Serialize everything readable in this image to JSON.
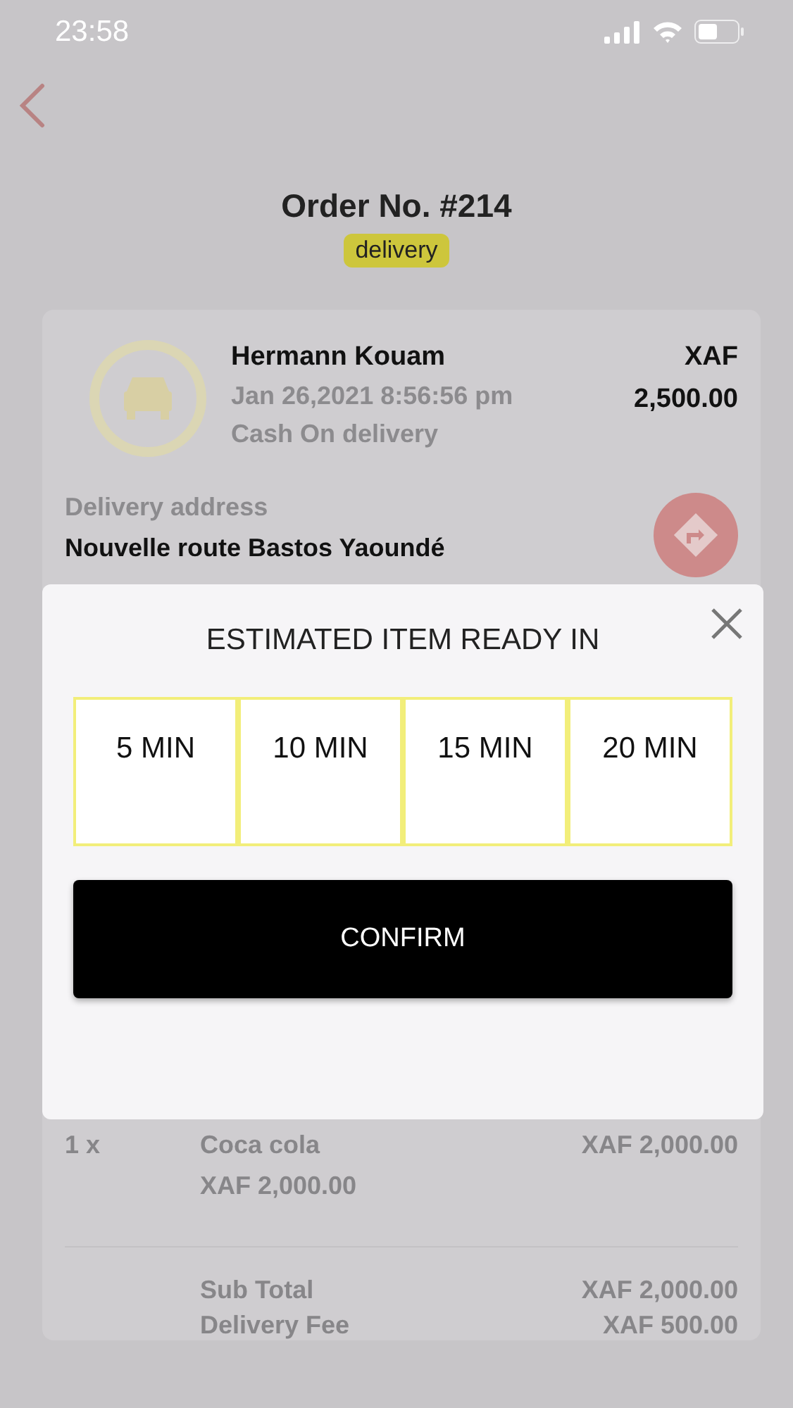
{
  "status_bar": {
    "time": "23:58"
  },
  "order": {
    "title": "Order No. #214",
    "type_badge": "delivery"
  },
  "customer": {
    "name": "Hermann Kouam",
    "date": "Jan 26,2021 8:56:56 pm",
    "payment": "Cash On delivery",
    "currency": "XAF",
    "amount": "2,500.00"
  },
  "delivery": {
    "label": "Delivery address",
    "address": "Nouvelle route Bastos Yaoundé"
  },
  "items": [
    {
      "qty": "1 x",
      "name": "Coca cola",
      "unit_price": "XAF 2,000.00",
      "total": "XAF 2,000.00"
    }
  ],
  "totals": [
    {
      "label": "Sub Total",
      "value": "XAF 2,000.00"
    },
    {
      "label": "Delivery Fee",
      "value": "XAF 500.00"
    }
  ],
  "dialog": {
    "title": "ESTIMATED ITEM READY IN",
    "options": [
      "5 MIN",
      "10 MIN",
      "15 MIN",
      "20 MIN"
    ],
    "confirm": "CONFIRM"
  }
}
